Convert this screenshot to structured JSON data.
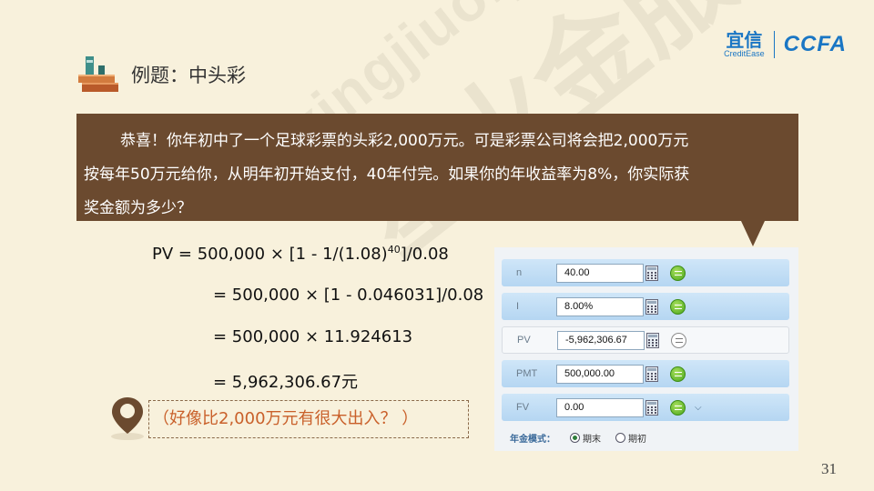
{
  "watermark": {
    "text": "xingjiuo.yixin.com"
  },
  "logo": {
    "brand_cn": "宜信",
    "brand_en": "CreditEase",
    "partner": "CCFA"
  },
  "header": {
    "title": "例题：中头彩"
  },
  "callout": {
    "lines": [
      "恭喜！你年初中了一个足球彩票的头彩2,000万元。可是彩票公司将会把2,000万元",
      "按每年50万元给你，从明年初开始支付，40年付完。如果你的年收益率为8%，你实际获",
      "奖金额为多少？"
    ]
  },
  "formula": {
    "line1_pre": "PV = 500,000 ×   [1 - 1/(1.08)",
    "line1_exp": "40",
    "line1_post": "]/0.08",
    "line2": "= 500,000 ×  [1 - 0.046031]/0.08",
    "line3": "= 500,000 ×  11.924613",
    "line4": "= 5,962,306.67元"
  },
  "hint": {
    "text": "（好像比2,000万元有很大出入？ ）"
  },
  "calculator": {
    "rows": [
      {
        "label": "n",
        "value": "40.00",
        "active": true
      },
      {
        "label": "I",
        "value": "8.00%",
        "active": true
      },
      {
        "label": "PV",
        "value": "-5,962,306.67",
        "active": false
      },
      {
        "label": "PMT",
        "value": "500,000.00",
        "active": true
      },
      {
        "label": "FV",
        "value": "0.00",
        "active": true
      }
    ],
    "mode_label": "年金模式：",
    "mode_options": [
      "期末",
      "期初"
    ],
    "mode_selected": "期末"
  },
  "page": {
    "number": "31"
  },
  "colors": {
    "background": "#f8f1dc",
    "callout": "#6b4a2f",
    "brand": "#1a76c4",
    "hint_text": "#c9602a"
  }
}
